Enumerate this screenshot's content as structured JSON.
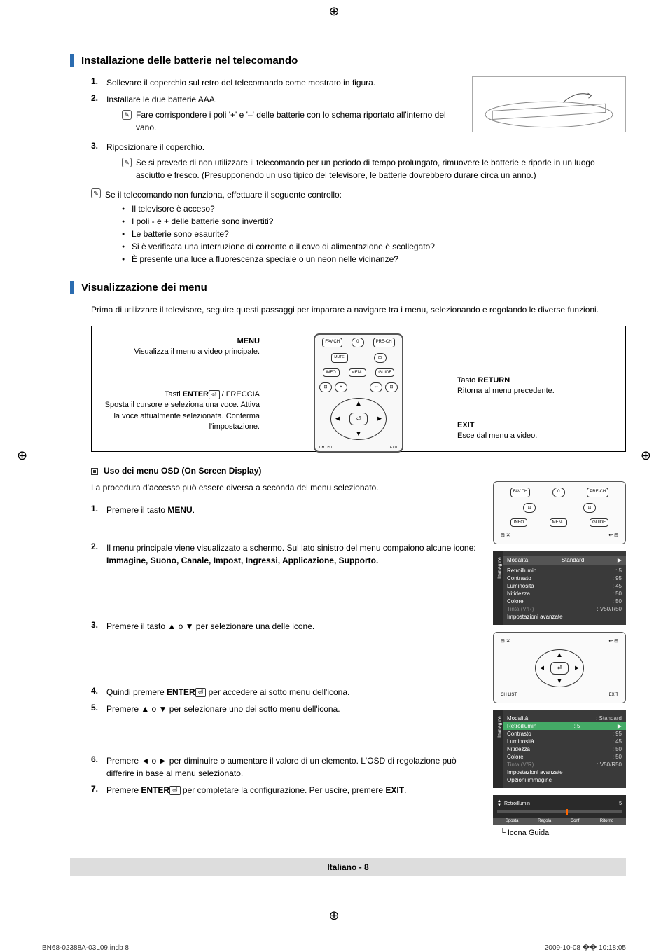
{
  "regmark": "⊕",
  "section1": {
    "title": "Installazione delle batterie nel telecomando",
    "steps": [
      {
        "num": "1.",
        "text": "Sollevare il coperchio sul retro del telecomando come mostrato in figura."
      },
      {
        "num": "2.",
        "text": "Installare le due batterie AAA.",
        "note": "Fare corrispondere i poli '+' e '–' delle batterie con lo schema riportato all'interno del vano."
      },
      {
        "num": "3.",
        "text": "Riposizionare il coperchio.",
        "note": "Se si prevede di non utilizzare il telecomando per un periodo di tempo prolungato, rimuovere le batterie e riporle in un luogo asciutto e fresco. (Presupponendo un uso tipico del televisore, le batterie dovrebbero durare circa un anno.)"
      }
    ],
    "check_intro": "Se il telecomando non funziona, effettuare il seguente controllo:",
    "checks": [
      "Il televisore è acceso?",
      "I poli - e + delle batterie sono invertiti?",
      "Le batterie sono esaurite?",
      "Si è verificata una interruzione di corrente o il cavo di alimentazione è scollegato?",
      "È presente una luce a fluorescenza speciale o un neon nelle vicinanze?"
    ]
  },
  "section2": {
    "title": "Visualizzazione dei menu",
    "intro": "Prima di utilizzare il televisore, seguire questi passaggi per imparare a navigare tra i menu, selezionando e regolando le diverse funzioni.",
    "callouts": {
      "menu_title": "MENU",
      "menu_desc": "Visualizza il menu a video principale.",
      "enter_title_pre": "Tasti ",
      "enter_title_bold": "ENTER",
      "enter_title_post": " / FRECCIA",
      "enter_desc": "Sposta il cursore e seleziona una voce. Attiva la voce attualmente selezionata. Conferma l'impostazione.",
      "return_title_pre": "Tasto ",
      "return_title_bold": "RETURN",
      "return_desc": "Ritorna al menu precedente.",
      "exit_title": "EXIT",
      "exit_desc": "Esce dal menu a video."
    },
    "remote_buttons": {
      "favch": "FAV.CH",
      "zero": "0",
      "prech": "PRE-CH",
      "mute": "MUTE",
      "sub": "⊡",
      "info": "INFO",
      "menu": "MENU",
      "guide": "GUIDE",
      "tools_l": "⊟",
      "tools": "✕",
      "return": "↩",
      "tools_r": "⊟",
      "chlist": "CH LIST",
      "exit": "EXIT",
      "enter": "⏎"
    },
    "osd_heading": "Uso dei menu OSD (On Screen Display)",
    "osd_intro": "La procedura d'accesso può essere diversa a seconda del menu selezionato.",
    "osd_steps": [
      {
        "num": "1.",
        "text_pre": "Premere il tasto ",
        "bold": "MENU",
        "text_post": "."
      },
      {
        "num": "2.",
        "text_pre": "Il menu principale viene visualizzato a schermo. Sul lato sinistro del menu compaiono alcune icone: ",
        "bold": "Immagine, Suono, Canale, Impost, Ingressi, Applicazione, Supporto.",
        "text_post": ""
      },
      {
        "num": "3.",
        "text_pre": "Premere il tasto ▲ o ▼ per selezionare una delle icone.",
        "bold": "",
        "text_post": ""
      },
      {
        "num": "4.",
        "text_pre": "Quindi premere ",
        "bold": "ENTER",
        "text_post": " per accedere ai sotto menu dell'icona.",
        "icon": true
      },
      {
        "num": "5.",
        "text_pre": "Premere ▲ o ▼ per selezionare uno dei sotto menu dell'icona.",
        "bold": "",
        "text_post": ""
      },
      {
        "num": "6.",
        "text_pre": "Premere ◄ o ► per diminuire o aumentare il valore di un elemento. L'OSD di regolazione può differire in base al menu selezionato.",
        "bold": "",
        "text_post": ""
      },
      {
        "num": "7.",
        "text_pre": "Premere ",
        "bold": "ENTER",
        "text_post": " per completare la configurazione. Per uscire, premere ",
        "icon": true,
        "bold2": "EXIT",
        "text_post2": "."
      }
    ],
    "osd_panel1": {
      "side": "Immagine",
      "header": {
        "l": "Modalità",
        "r": "Standard"
      },
      "rows": [
        {
          "l": "Retroillumin",
          "r": ": 5"
        },
        {
          "l": "Contrasto",
          "r": ": 95"
        },
        {
          "l": "Luminosità",
          "r": ": 45"
        },
        {
          "l": "Nitidezza",
          "r": ": 50"
        },
        {
          "l": "Colore",
          "r": ": 50"
        },
        {
          "l": "Tinta (V/R)",
          "r": ": V50/R50",
          "dim": true
        },
        {
          "l": "Impostazioni avanzate",
          "r": ""
        }
      ]
    },
    "osd_panel2": {
      "side": "Immagine",
      "pre_header": {
        "l": "Modalità",
        "r": ": Standard"
      },
      "hl": {
        "l": "Retroillumin",
        "r": ": 5",
        "arrow": "▶"
      },
      "rows": [
        {
          "l": "Contrasto",
          "r": ": 95"
        },
        {
          "l": "Luminosità",
          "r": ": 45"
        },
        {
          "l": "Nitidezza",
          "r": ": 50"
        },
        {
          "l": "Colore",
          "r": ": 50"
        },
        {
          "l": "Tinta (V/R)",
          "r": ": V50/R50",
          "dim": true
        },
        {
          "l": "Impostazioni avanzate",
          "r": ""
        },
        {
          "l": "Opzioni immagine",
          "r": ""
        }
      ]
    },
    "slider": {
      "label": "Retroillumin",
      "value": "5",
      "footer": [
        "Sposta",
        "Regola",
        "Conf.",
        "Ritorno"
      ]
    },
    "guide_label": "Icona Guida"
  },
  "footer_center": "Italiano - 8",
  "doc_footer": {
    "left": "BN68-02388A-03L09.indb   8",
    "right": "2009-10-08   �� 10:18:05"
  }
}
